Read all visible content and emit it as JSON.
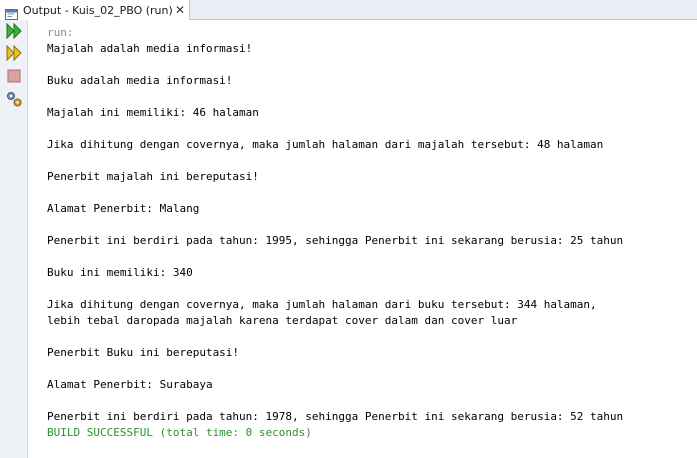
{
  "tab": {
    "title": "Output - Kuis_02_PBO (run)",
    "icon": "output-window-icon",
    "close_glyph": "✕"
  },
  "toolbar": {
    "buttons": [
      {
        "icon": "rerun-icon",
        "color": "#2e9b2e"
      },
      {
        "icon": "rerun-with-options-icon",
        "color": "#c7a500"
      },
      {
        "icon": "stop-icon",
        "color": "#c87c7c"
      },
      {
        "icon": "settings-icon",
        "color": "#4a6fa5"
      }
    ]
  },
  "console": {
    "lines": [
      {
        "type": "run",
        "text": "run:"
      },
      {
        "type": "output",
        "text": "Majalah adalah media informasi!"
      },
      {
        "type": "output",
        "text": ""
      },
      {
        "type": "output",
        "text": "Buku adalah media informasi!"
      },
      {
        "type": "output",
        "text": ""
      },
      {
        "type": "output",
        "text": "Majalah ini memiliki: 46 halaman"
      },
      {
        "type": "output",
        "text": ""
      },
      {
        "type": "output",
        "text": "Jika dihitung dengan covernya, maka jumlah halaman dari majalah tersebut: 48 halaman"
      },
      {
        "type": "output",
        "text": ""
      },
      {
        "type": "output",
        "text": "Penerbit majalah ini bereputasi!"
      },
      {
        "type": "output",
        "text": ""
      },
      {
        "type": "output",
        "text": "Alamat Penerbit: Malang"
      },
      {
        "type": "output",
        "text": ""
      },
      {
        "type": "output",
        "text": "Penerbit ini berdiri pada tahun: 1995, sehingga Penerbit ini sekarang berusia: 25 tahun"
      },
      {
        "type": "output",
        "text": ""
      },
      {
        "type": "output",
        "text": "Buku ini memiliki: 340"
      },
      {
        "type": "output",
        "text": ""
      },
      {
        "type": "output",
        "text": "Jika dihitung dengan covernya, maka jumlah halaman dari buku tersebut: 344 halaman,"
      },
      {
        "type": "output",
        "text": "lebih tebal daropada majalah karena terdapat cover dalam dan cover luar"
      },
      {
        "type": "output",
        "text": ""
      },
      {
        "type": "output",
        "text": "Penerbit Buku ini bereputasi!"
      },
      {
        "type": "output",
        "text": ""
      },
      {
        "type": "output",
        "text": "Alamat Penerbit: Surabaya"
      },
      {
        "type": "output",
        "text": ""
      },
      {
        "type": "output",
        "text": "Penerbit ini berdiri pada tahun: 1978, sehingga Penerbit ini sekarang berusia: 52 tahun"
      },
      {
        "type": "success",
        "text": "BUILD SUCCESSFUL (total time: 0 seconds)"
      }
    ]
  }
}
